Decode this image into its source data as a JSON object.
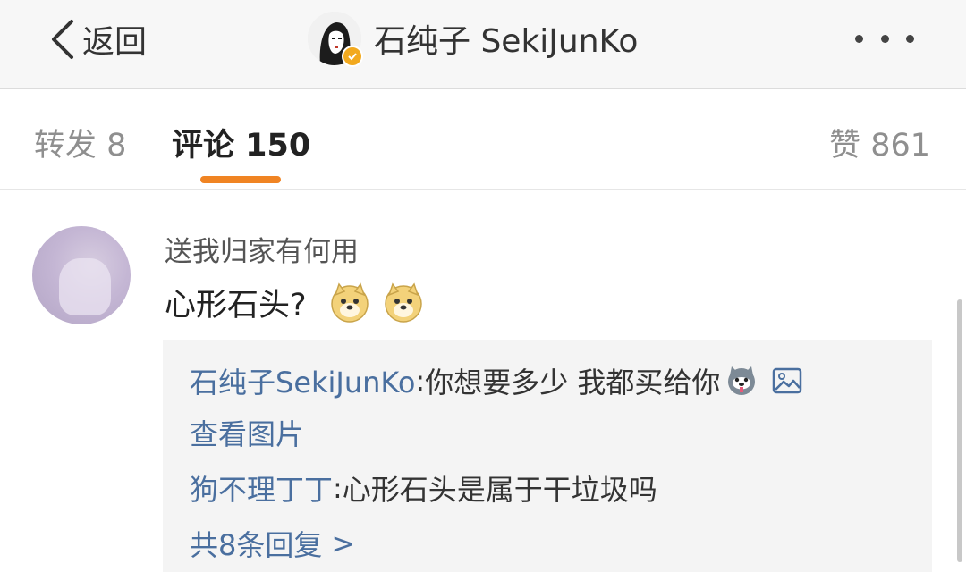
{
  "nav": {
    "back_label": "返回",
    "title": "石纯子 SekiJunKo",
    "more_icon": "more-dots-icon"
  },
  "tabs": {
    "forward": "转发 8",
    "comment": "评论 150",
    "like": "赞 861",
    "active": "comment",
    "accent_color": "#f08423"
  },
  "comment": {
    "user": "送我归家有何用",
    "text": "心形石头?",
    "emojis": [
      "doge-emoji",
      "doge-emoji"
    ]
  },
  "replies": [
    {
      "author": "石纯子SekiJunKo",
      "separator": ": ",
      "content": "你想要多少 我都买给你",
      "emoji": "husky-emoji",
      "image_link": "查看图片"
    },
    {
      "author": "狗不理丁丁",
      "separator": ": ",
      "content": "心形石头是属于干垃圾吗"
    }
  ],
  "more_replies": "共8条回复",
  "colors": {
    "link": "#4a6f9f",
    "nav_bg": "#f7f7f7",
    "reply_bg": "#f4f4f4"
  }
}
